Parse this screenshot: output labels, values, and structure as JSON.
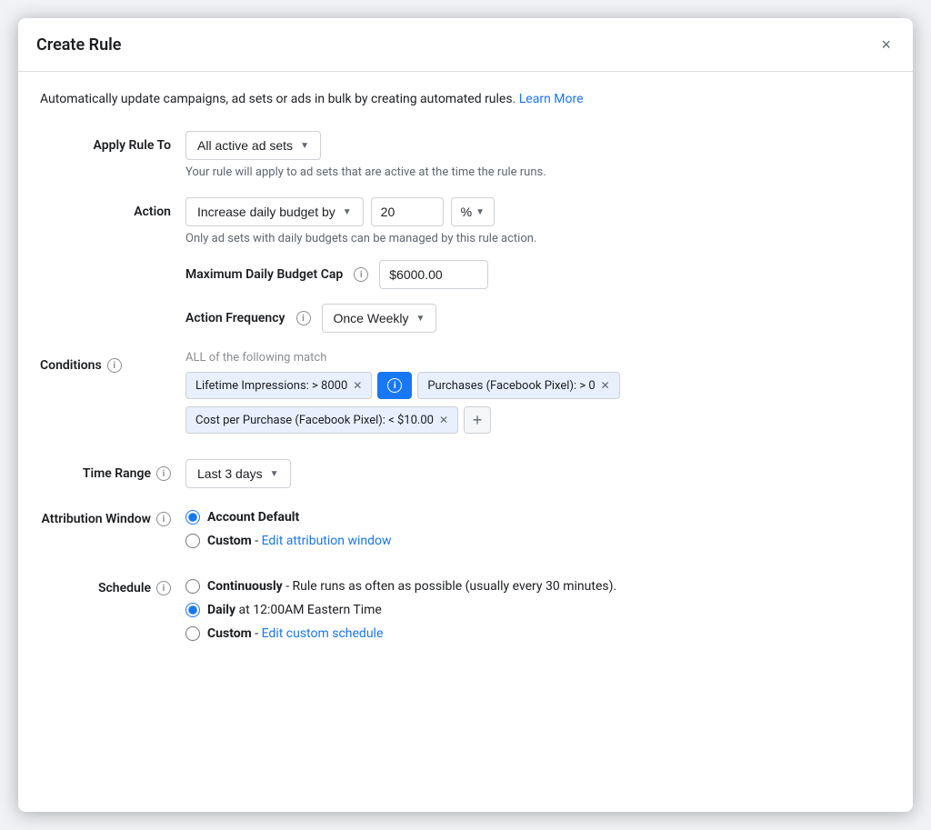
{
  "modal": {
    "title": "Create Rule",
    "close_label": "×"
  },
  "intro": {
    "text": "Automatically update campaigns, ad sets or ads in bulk by creating automated rules.",
    "learn_more": "Learn More"
  },
  "apply_rule": {
    "label": "Apply Rule To",
    "dropdown_label": "All active ad sets",
    "hint": "Your rule will apply to ad sets that are active at the time the rule runs."
  },
  "action": {
    "label": "Action",
    "dropdown_label": "Increase daily budget by",
    "amount": "20",
    "unit": "%",
    "hint": "Only ad sets with daily budgets can be managed by this rule action.",
    "budget_cap_label": "Maximum Daily Budget Cap",
    "budget_cap_value": "$6000.00",
    "frequency_label": "Action Frequency",
    "frequency_value": "Once Weekly"
  },
  "conditions": {
    "label": "Conditions",
    "hint": "ALL of the following match",
    "tags": [
      {
        "text": "Lifetime Impressions:  > 8000",
        "active_info": false
      },
      {
        "text": "Purchases (Facebook Pixel):  > 0",
        "active_info": false
      },
      {
        "text": "Cost per Purchase (Facebook Pixel):  < $10.00",
        "active_info": false
      }
    ],
    "add_label": "+"
  },
  "time_range": {
    "label": "Time Range",
    "value": "Last 3 days"
  },
  "attribution_window": {
    "label": "Attribution Window",
    "options": [
      {
        "label": "Account Default",
        "checked": true
      },
      {
        "label": "Custom",
        "checked": false,
        "edit_text": "Edit attribution window"
      }
    ]
  },
  "schedule": {
    "label": "Schedule",
    "options": [
      {
        "label": "Continuously",
        "detail": "Rule runs as often as possible (usually every 30 minutes).",
        "checked": false
      },
      {
        "label": "Daily",
        "detail": "at 12:00AM Eastern Time",
        "checked": true
      },
      {
        "label": "Custom",
        "detail": "",
        "checked": false,
        "edit_text": "Edit custom schedule"
      }
    ]
  }
}
